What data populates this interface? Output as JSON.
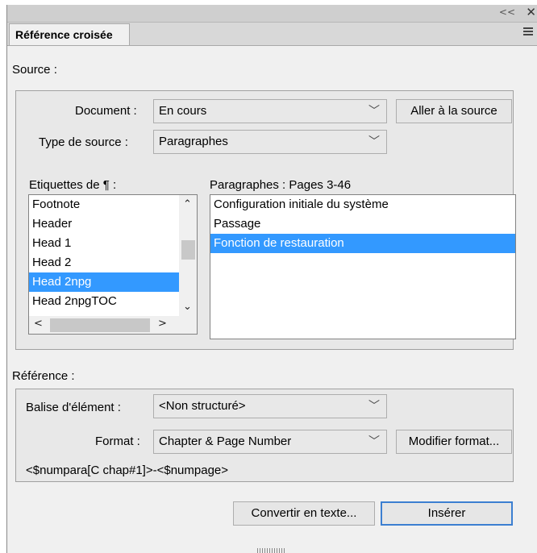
{
  "panel": {
    "tab_label": "Référence croisée",
    "collapse_icon": "double-chevron-left-icon",
    "close_icon": "close-x-icon",
    "menu_icon": "panel-menu-icon"
  },
  "source": {
    "heading": "Source :",
    "document_label": "Document :",
    "document_value": "En cours",
    "goto_button": "Aller à la source",
    "type_label": "Type de source :",
    "type_value": "Paragraphes",
    "tags_label": "Etiquettes de ¶ :",
    "tags": [
      {
        "label": "Footnote",
        "selected": false
      },
      {
        "label": "Header",
        "selected": false
      },
      {
        "label": "Head 1",
        "selected": false
      },
      {
        "label": "Head 2",
        "selected": false
      },
      {
        "label": "Head 2npg",
        "selected": true
      },
      {
        "label": "Head 2npgTOC",
        "selected": false
      }
    ],
    "paragraphs_label": "Paragraphes : Pages  3-46",
    "paragraphs": [
      {
        "label": "Configuration initiale du système",
        "selected": false
      },
      {
        "label": "Passage",
        "selected": false
      },
      {
        "label": "Fonction de restauration",
        "selected": true
      }
    ]
  },
  "reference": {
    "heading": "Référence :",
    "element_tag_label": "Balise d'élément :",
    "element_tag_value": "<Non structuré>",
    "format_label": "Format :",
    "format_value": "Chapter & Page Number",
    "modify_button": "Modifier format...",
    "format_code": "<$numpara[C chap#1]>-<$numpage>"
  },
  "actions": {
    "convert_button": "Convertir en texte...",
    "insert_button": "Insérer"
  },
  "colors": {
    "selection": "#3399ff",
    "default_button_border": "#3c7fd1"
  }
}
